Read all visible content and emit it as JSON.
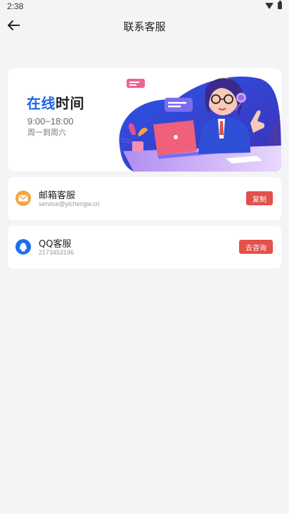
{
  "status_bar": {
    "time": "2:38"
  },
  "header": {
    "title": "联系客服"
  },
  "banner": {
    "title_accent": "在线",
    "title_rest": "时间",
    "hours": "9:00~18:00",
    "days": "周一到周六"
  },
  "contacts": [
    {
      "title": "邮箱客服",
      "subtitle": "service@yichengw.cn",
      "button": "复制",
      "icon": "mail-icon",
      "icon_color": "#f5a442"
    },
    {
      "title": "QQ客服",
      "subtitle": "2173453196",
      "button": "去咨询",
      "icon": "qq-icon",
      "icon_color": "#1a6ff2"
    }
  ],
  "colors": {
    "accent": "#1e63e6",
    "button": "#e2514a",
    "background": "#f4f4f6"
  }
}
